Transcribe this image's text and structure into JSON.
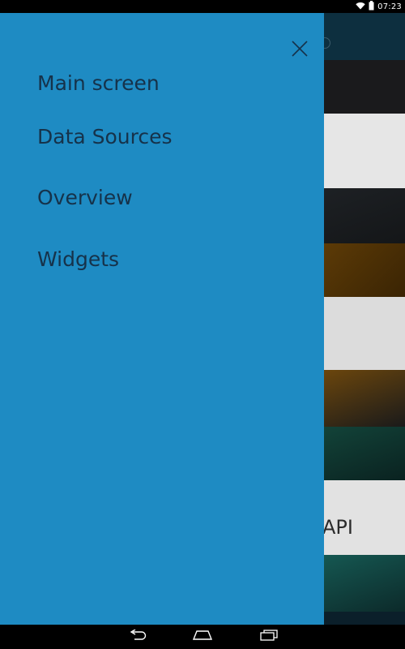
{
  "status_bar": {
    "time": "07:23",
    "icons": [
      "wifi-icon",
      "battery-icon"
    ]
  },
  "drawer": {
    "close_icon": "close-icon",
    "color": "#1e8bc3",
    "items": [
      {
        "label": "Main screen"
      },
      {
        "label": "Data Sources"
      },
      {
        "label": "Overview"
      },
      {
        "label": "Widgets"
      }
    ]
  },
  "background": {
    "partial_label": "API"
  },
  "nav_bar": {
    "icons": [
      "back-icon",
      "home-icon",
      "recent-apps-icon"
    ]
  }
}
